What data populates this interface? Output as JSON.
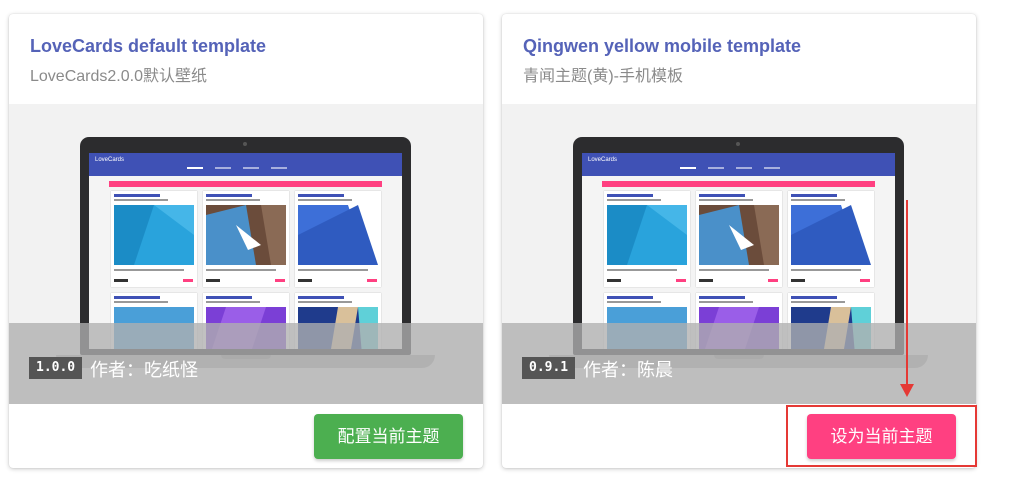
{
  "themes": [
    {
      "title": "LoveCards default template",
      "subtitle": "LoveCards2.0.0默认壁纸",
      "version": "1.0.0",
      "author": "作者：吃纸怪",
      "button_label": "配置当前主题",
      "button_color": "#4caf50"
    },
    {
      "title": "Qingwen yellow mobile template",
      "subtitle": "青闻主题(黄)-手机模板",
      "version": "0.9.1",
      "author": "作者：陈晨",
      "button_label": "设为当前主题",
      "button_color": "#ff4081"
    }
  ],
  "preview": {
    "app_name": "LoveCards"
  },
  "colors": {
    "title": "#5563b8",
    "app_bar": "#3f51b5",
    "accent_pink": "#ff4081",
    "annotation_red": "#e53935"
  }
}
